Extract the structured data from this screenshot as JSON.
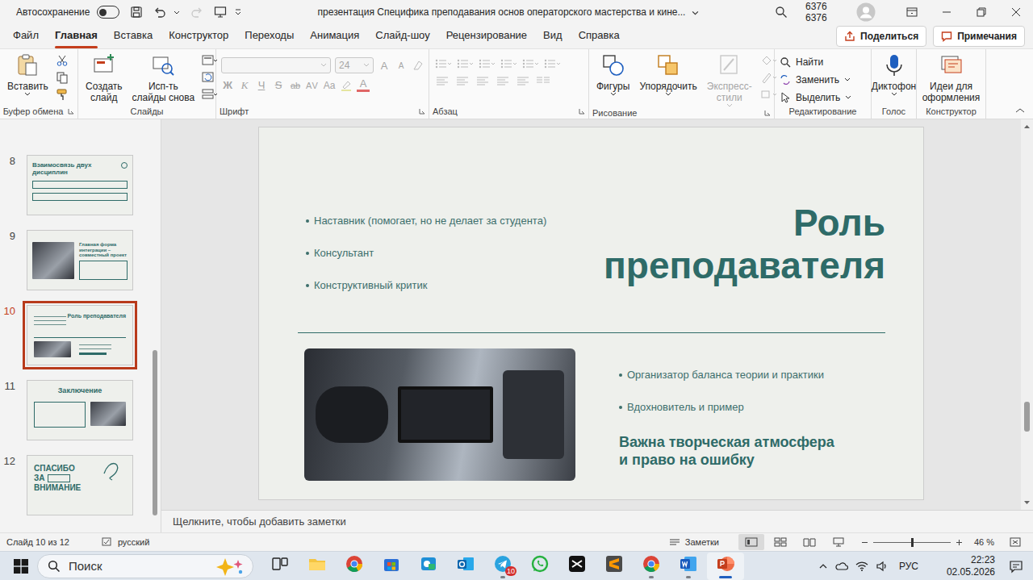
{
  "window": {
    "title": "презентация Специфика преподавания основ операторского мастерства и кине...",
    "autosave": {
      "label": "Автосохранение",
      "on": false
    },
    "user": "6376 6376"
  },
  "tabs": [
    {
      "label": "Файл",
      "selected": false
    },
    {
      "label": "Главная",
      "selected": true
    },
    {
      "label": "Вставка",
      "selected": false
    },
    {
      "label": "Конструктор",
      "selected": false
    },
    {
      "label": "Переходы",
      "selected": false
    },
    {
      "label": "Анимация",
      "selected": false
    },
    {
      "label": "Слайд-шоу",
      "selected": false
    },
    {
      "label": "Рецензирование",
      "selected": false
    },
    {
      "label": "Вид",
      "selected": false
    },
    {
      "label": "Справка",
      "selected": false
    }
  ],
  "header_buttons": {
    "share": "Поделиться",
    "comments": "Примечания"
  },
  "ribbon": {
    "clipboard": {
      "label": "Буфер обмена",
      "paste": "Вставить"
    },
    "slides": {
      "label": "Слайды",
      "new_slide": [
        "Создать",
        "слайд"
      ],
      "reuse": [
        "Исп-ть",
        "слайды снова"
      ]
    },
    "font": {
      "label": "Шрифт",
      "font_size": "24",
      "disabled": true,
      "size_buttons": [
        "A",
        "A"
      ],
      "format_buttons": [
        "Ж",
        "К",
        "Ч",
        "S",
        "ab",
        "AV",
        "Aa"
      ],
      "color_button": "A"
    },
    "paragraph": {
      "label": "Абзац",
      "disabled": true
    },
    "drawing": {
      "label": "Рисование",
      "buttons": [
        {
          "lines": [
            "Фигуры"
          ],
          "kind": "shapes",
          "disabled": false
        },
        {
          "lines": [
            "Упорядочить"
          ],
          "kind": "arrange",
          "disabled": false
        },
        {
          "lines": [
            "Экспресс-",
            "стили"
          ],
          "kind": "styles",
          "disabled": true
        }
      ]
    },
    "editing": {
      "label": "Редактирование",
      "buttons": [
        {
          "label": "Найти",
          "kind": "find",
          "caret": false
        },
        {
          "label": "Заменить",
          "kind": "replace",
          "caret": true
        },
        {
          "label": "Выделить",
          "kind": "select",
          "caret": true
        }
      ]
    },
    "voice": {
      "label": "Голос",
      "button": "Диктофон"
    },
    "designer": {
      "label": "Конструктор",
      "button": [
        "Идеи для",
        "оформления"
      ]
    }
  },
  "thumbnails": [
    {
      "number": "8",
      "kind": "boxes",
      "title": "Взаимосвязь двух дисциплин",
      "lines": [],
      "selected": false
    },
    {
      "number": "9",
      "kind": "project",
      "title": "Главная форма интеграции – совместный проект",
      "lines": [],
      "selected": false
    },
    {
      "number": "10",
      "kind": "role",
      "title": "Роль преподавателя",
      "lines": [],
      "selected": true
    },
    {
      "number": "11",
      "kind": "conclusion",
      "title": "Заключение",
      "lines": [],
      "selected": false
    },
    {
      "number": "12",
      "kind": "thanks",
      "title": "",
      "lines": [
        "СПАСИБО",
        "ЗА",
        "ВНИМАНИЕ"
      ],
      "selected": false
    }
  ],
  "thumbnail_scroll": {
    "position": 0.56,
    "size": 0.41
  },
  "slide": {
    "title": [
      "Роль",
      "преподавателя"
    ],
    "top_bullets": [
      "Наставник (помогает, но не делает за студента)",
      "Консультант",
      "Конструктивный критик"
    ],
    "bottom_bullets": [
      "Организатор баланса теории и практики",
      "Вдохновитель и пример"
    ],
    "emphasis": [
      "Важна творческая атмосфера",
      "и право на ошибку"
    ]
  },
  "slide_scroll": {
    "position": 0.74,
    "size": 0.08
  },
  "notes": {
    "placeholder": "Щелкните, чтобы добавить заметки"
  },
  "status_bar": {
    "slide": "Слайд 10 из 12",
    "language": "русский",
    "notes": "Заметки",
    "zoom": "46 %",
    "zoom_level": 0.5
  },
  "taskbar": {
    "search": "Поиск",
    "apps": [
      {
        "kind": "taskview",
        "running": false,
        "active": false,
        "badge": ""
      },
      {
        "kind": "explorer",
        "running": false,
        "active": false,
        "badge": ""
      },
      {
        "kind": "chrome",
        "running": false,
        "active": false,
        "badge": ""
      },
      {
        "kind": "store",
        "running": false,
        "active": false,
        "badge": ""
      },
      {
        "kind": "snip",
        "running": false,
        "active": false,
        "badge": ""
      },
      {
        "kind": "outlook",
        "running": false,
        "active": false,
        "badge": ""
      },
      {
        "kind": "telegram",
        "running": true,
        "active": false,
        "badge": "10"
      },
      {
        "kind": "whatsapp",
        "running": false,
        "active": false,
        "badge": ""
      },
      {
        "kind": "capcut",
        "running": false,
        "active": false,
        "badge": ""
      },
      {
        "kind": "sublime",
        "running": false,
        "active": false,
        "badge": ""
      },
      {
        "kind": "chrome",
        "running": true,
        "active": false,
        "badge": ""
      },
      {
        "kind": "word",
        "running": true,
        "active": false,
        "badge": ""
      },
      {
        "kind": "powerpoint",
        "running": true,
        "active": true,
        "badge": ""
      }
    ],
    "language": "РУС",
    "time": "22:23",
    "date": "02.05.2026"
  }
}
